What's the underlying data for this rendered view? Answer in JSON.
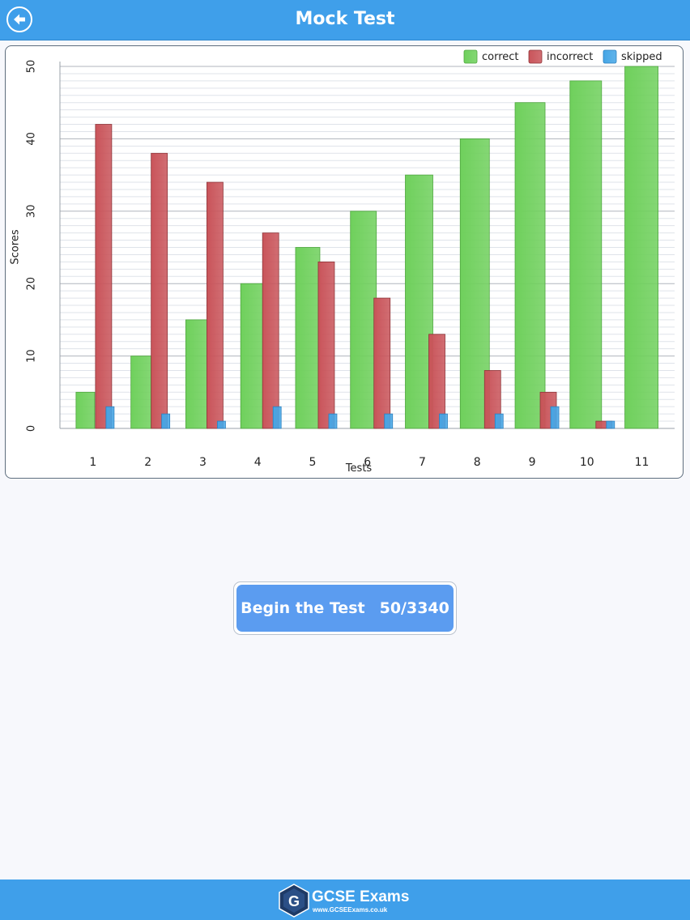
{
  "header": {
    "title": "Mock Test",
    "back_icon": "back-arrow-icon"
  },
  "colors": {
    "header_bg": "#3f9fea",
    "correct": "#6fd05c",
    "incorrect": "#c9545a",
    "skipped": "#45a6e6",
    "button": "#5b9cf0"
  },
  "chart_data": {
    "type": "bar",
    "title": "",
    "xlabel": "Tests",
    "ylabel": "Scores",
    "ylim": [
      0,
      50
    ],
    "yticks": [
      0,
      10,
      20,
      30,
      40,
      50
    ],
    "grid": true,
    "legend_position": "top-right",
    "categories": [
      "1",
      "2",
      "3",
      "4",
      "5",
      "6",
      "7",
      "8",
      "9",
      "10",
      "11"
    ],
    "series": [
      {
        "name": "correct",
        "values": [
          5,
          10,
          15,
          20,
          25,
          30,
          35,
          40,
          45,
          48,
          50
        ]
      },
      {
        "name": "incorrect",
        "values": [
          42,
          38,
          34,
          27,
          23,
          18,
          13,
          8,
          5,
          1,
          0
        ]
      },
      {
        "name": "skipped",
        "values": [
          3,
          2,
          1,
          3,
          2,
          2,
          2,
          2,
          3,
          1,
          0
        ]
      }
    ]
  },
  "begin_button": {
    "label": "Begin the Test",
    "count": "50/3340"
  },
  "footer": {
    "logo_letter": "G",
    "logo_name": "GCSE Exams",
    "logo_url": "www.GCSEExams.co.uk"
  }
}
